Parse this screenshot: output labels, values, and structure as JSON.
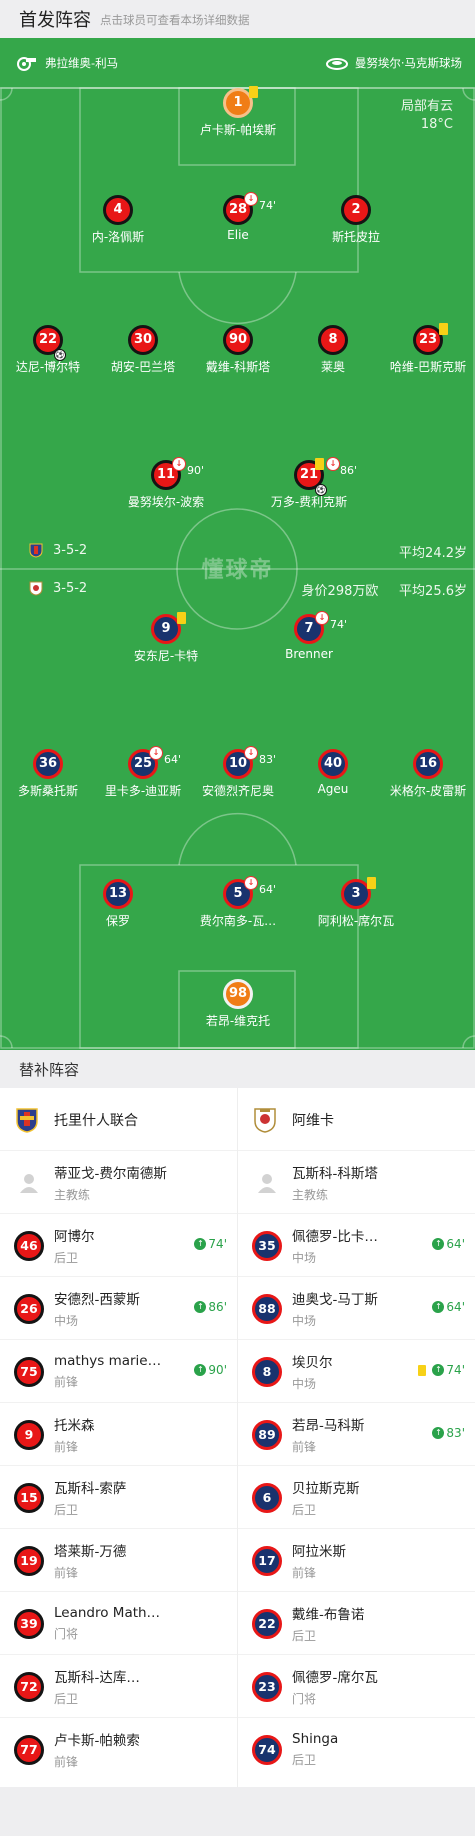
{
  "header": {
    "title": "首发阵容",
    "subtitle": "点击球员可查看本场详细数据"
  },
  "pitch": {
    "home_team": "弗拉维奥-利马",
    "stadium": "曼努埃尔·马克斯球场",
    "weather": "局部有云",
    "temperature": "18°C",
    "watermark": "懂球帝",
    "home_formation": "3-5-2",
    "home_avg_age": "平均24.2岁",
    "away_formation": "3-5-2",
    "away_value": "身价298万欧",
    "away_avg_age": "平均25.6岁",
    "home_players": [
      {
        "num": "1",
        "name": "卢卡斯-帕埃斯"
      },
      {
        "num": "4",
        "name": "内-洛佩斯"
      },
      {
        "num": "28",
        "name": "Elie",
        "minute": "74'"
      },
      {
        "num": "2",
        "name": "斯托皮拉"
      },
      {
        "num": "22",
        "name": "达尼-博尔特"
      },
      {
        "num": "30",
        "name": "胡安-巴兰塔"
      },
      {
        "num": "90",
        "name": "戴维-科斯塔"
      },
      {
        "num": "8",
        "name": "莱奥"
      },
      {
        "num": "23",
        "name": "哈维-巴斯克斯"
      },
      {
        "num": "11",
        "name": "曼努埃尔-波索",
        "minute": "90'"
      },
      {
        "num": "21",
        "name": "万多-费利克斯",
        "minute": "86'"
      }
    ],
    "away_players": [
      {
        "num": "9",
        "name": "安东尼-卡特"
      },
      {
        "num": "7",
        "name": "Brenner",
        "minute": "74'"
      },
      {
        "num": "36",
        "name": "多斯桑托斯"
      },
      {
        "num": "25",
        "name": "里卡多-迪亚斯",
        "minute": "64'"
      },
      {
        "num": "10",
        "name": "安德烈齐尼奥",
        "minute": "83'"
      },
      {
        "num": "40",
        "name": "Ageu"
      },
      {
        "num": "16",
        "name": "米格尔-皮雷斯"
      },
      {
        "num": "13",
        "name": "保罗"
      },
      {
        "num": "5",
        "name": "费尔南多-瓦…",
        "minute": "64'"
      },
      {
        "num": "3",
        "name": "阿利松-席尔瓦"
      },
      {
        "num": "98",
        "name": "若昂-维克托"
      }
    ]
  },
  "subs": {
    "title": "替补阵容",
    "home_team": "托里什人联合",
    "away_team": "阿维卡",
    "home_coach": {
      "name": "蒂亚戈-费尔南德斯",
      "role": "主教练"
    },
    "away_coach": {
      "name": "瓦斯科-科斯塔",
      "role": "主教练"
    },
    "home": [
      {
        "num": "46",
        "name": "阿博尔",
        "pos": "后卫",
        "minute": "74'"
      },
      {
        "num": "26",
        "name": "安德烈-西蒙斯",
        "pos": "中场",
        "minute": "86'"
      },
      {
        "num": "75",
        "name": "mathys marie…",
        "pos": "前锋",
        "minute": "90'"
      },
      {
        "num": "9",
        "name": "托米森",
        "pos": "前锋"
      },
      {
        "num": "15",
        "name": "瓦斯科-索萨",
        "pos": "后卫"
      },
      {
        "num": "19",
        "name": "塔莱斯-万德",
        "pos": "前锋"
      },
      {
        "num": "39",
        "name": "Leandro Math…",
        "pos": "门将"
      },
      {
        "num": "72",
        "name": "瓦斯科-达库…",
        "pos": "后卫"
      },
      {
        "num": "77",
        "name": "卢卡斯-帕赖索",
        "pos": "前锋"
      }
    ],
    "away": [
      {
        "num": "35",
        "name": "佩德罗-比卡…",
        "pos": "中场",
        "minute": "64'"
      },
      {
        "num": "88",
        "name": "迪奥戈-马丁斯",
        "pos": "中场",
        "minute": "64'"
      },
      {
        "num": "8",
        "name": "埃贝尔",
        "pos": "中场",
        "minute": "74'"
      },
      {
        "num": "89",
        "name": "若昂-马科斯",
        "pos": "前锋",
        "minute": "83'"
      },
      {
        "num": "6",
        "name": "贝拉斯克斯",
        "pos": "后卫"
      },
      {
        "num": "17",
        "name": "阿拉米斯",
        "pos": "前锋"
      },
      {
        "num": "22",
        "name": "戴维-布鲁诺",
        "pos": "后卫"
      },
      {
        "num": "23",
        "name": "佩德罗-席尔瓦",
        "pos": "门将"
      },
      {
        "num": "74",
        "name": "Shinga",
        "pos": "后卫"
      }
    ]
  },
  "colors": {
    "pitch": "#35a74a",
    "home_shirt": "#e81717",
    "away_shirt": "#19336e",
    "goalkeeper": "#f07d16",
    "yellow_card": "#f7d117",
    "sub_in": "#2aa24a"
  }
}
